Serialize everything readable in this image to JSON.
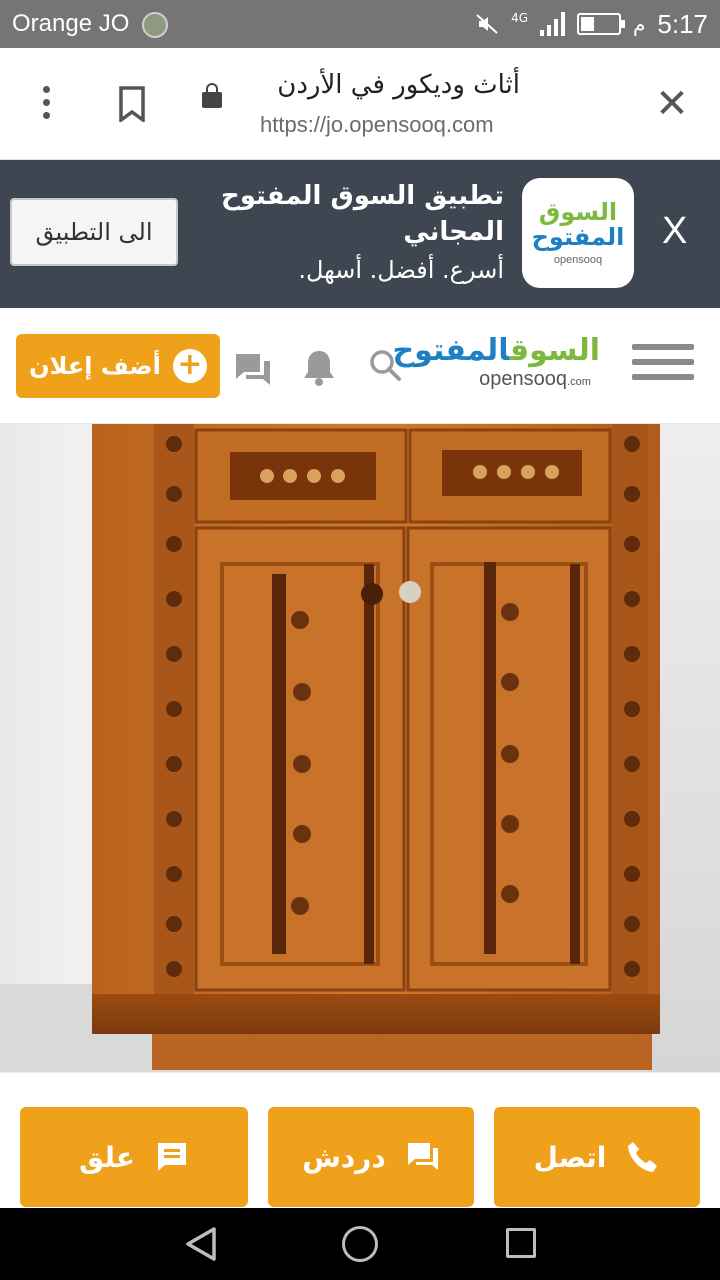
{
  "status_bar": {
    "carrier": "Orange JO",
    "network": "4G",
    "time": "5:17",
    "ampm": "م",
    "battery_level": 0.35
  },
  "browser": {
    "title": "أثاث وديكور في الأردن",
    "url": "https://jo.opensooq.com",
    "icons": [
      "menu-dots-icon",
      "bookmark-icon",
      "lock-icon",
      "close-icon"
    ]
  },
  "app_banner": {
    "close_label": "X",
    "logo_line1": "السوق",
    "logo_line2": "المفتوح",
    "logo_line3": "opensooq",
    "title": "تطبيق السوق المفتوح المجاني",
    "subtitle": "أسرع. أفضل. أسهل.",
    "button_label": "الى التطبيق",
    "background": "#3e4652"
  },
  "site_header": {
    "logo_ar_green": "السوق",
    "logo_ar_blue": "المفتوح",
    "logo_en": "opensooq",
    "logo_en_suffix": ".com",
    "add_ad_label": "أضف إعلان",
    "accent": "#f0a11b"
  },
  "product_image": {
    "alt": "wooden shoe cabinet"
  },
  "actions": {
    "comment_label": "علق",
    "chat_label": "دردش",
    "call_label": "اتصل"
  }
}
